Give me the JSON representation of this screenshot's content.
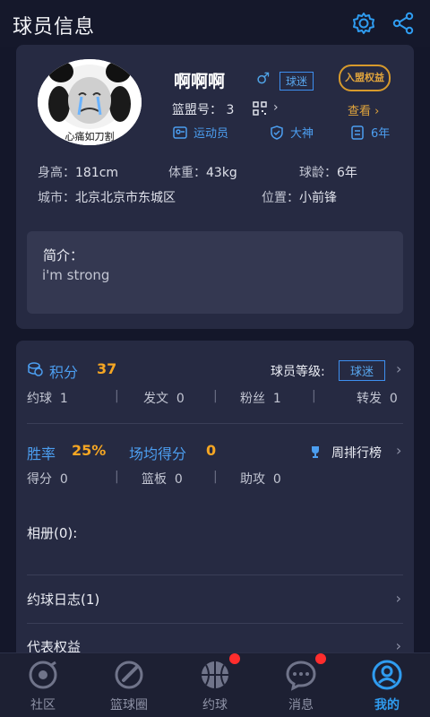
{
  "header": {
    "title": "球员信息",
    "settings_icon": "gear-icon",
    "share_icon": "share-icon"
  },
  "profile": {
    "avatar_caption": "心痛如刀割",
    "name": "啊啊啊",
    "gender": "♂",
    "fan_tag": "球迷",
    "vip_badge": "入盟权益",
    "league_no_label": "篮盟号：",
    "league_no": "3",
    "view_link": "查看",
    "tags": [
      "运动员",
      "大神",
      "6年"
    ],
    "height_label": "身高：",
    "height": "181cm",
    "weight_label": "体重：",
    "weight": "43kg",
    "age_label": "球龄：",
    "age": "6年",
    "city_label": "城市：",
    "city": "北京北京市东城区",
    "position_label": "位置：",
    "position": "小前锋",
    "intro_title": "简介：",
    "intro_text": "i'm strong"
  },
  "stats": {
    "points_label": "积分",
    "points_value": "37",
    "level_label": "球员等级:",
    "level_value": "球迷",
    "row1": [
      {
        "label": "约球",
        "value": "1"
      },
      {
        "label": "发文",
        "value": "0"
      },
      {
        "label": "粉丝",
        "value": "1"
      },
      {
        "label": "转发",
        "value": "0"
      }
    ],
    "win_label": "胜率",
    "win_value": "25%",
    "avg_label": "场均得分",
    "avg_value": "0",
    "rank_label": "周排行榜",
    "row2": [
      {
        "label": "得分",
        "value": "0"
      },
      {
        "label": "篮板",
        "value": "0"
      },
      {
        "label": "助攻",
        "value": "0"
      }
    ],
    "album": "相册(0):",
    "log": "约球日志(1)",
    "rights": "代表权益"
  },
  "tabs": [
    {
      "label": "社区",
      "icon": "community-icon",
      "active": false,
      "badge": false
    },
    {
      "label": "篮球圈",
      "icon": "basketball-circle-icon",
      "active": false,
      "badge": false
    },
    {
      "label": "约球",
      "icon": "basketball-icon",
      "active": false,
      "badge": true
    },
    {
      "label": "消息",
      "icon": "message-icon",
      "active": false,
      "badge": true
    },
    {
      "label": "我的",
      "icon": "profile-icon",
      "active": true,
      "badge": false
    }
  ],
  "colors": {
    "accent": "#2f9cf0",
    "gold": "#e0a43c",
    "orange": "#f5a623",
    "badge": "#ff2d2d"
  }
}
